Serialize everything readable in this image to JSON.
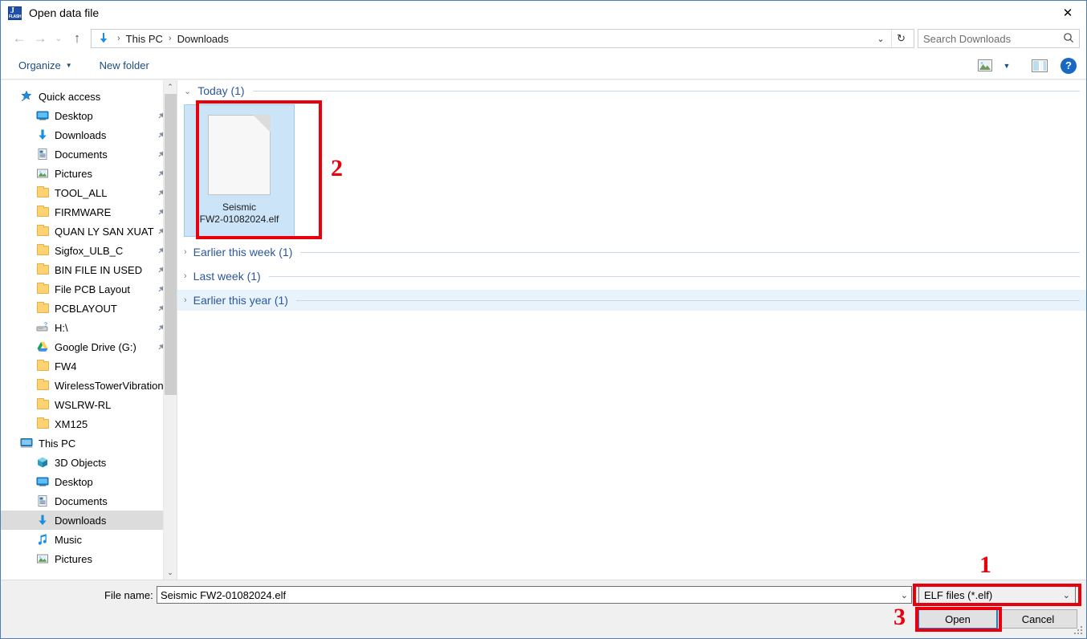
{
  "window": {
    "title": "Open data file",
    "app_icon": "jflash-icon",
    "icon_letter": "J",
    "icon_word": "FLASH",
    "close_label": "✕"
  },
  "addressbar": {
    "back": "←",
    "forward": "→",
    "recent": "⌄",
    "up": "↑",
    "crumbs": [
      "This PC",
      "Downloads"
    ],
    "separator": "›",
    "dropdown": "⌄",
    "refresh": "↻"
  },
  "search": {
    "placeholder": "Search Downloads",
    "icon": "⌕"
  },
  "commandbar": {
    "organize": "Organize",
    "organize_caret": "▼",
    "new_folder": "New folder",
    "view_caret": "▼",
    "help": "?"
  },
  "sidebar": {
    "items": [
      {
        "label": "Quick access",
        "icon": "star-icon",
        "level": 0,
        "pinned": false,
        "selected": false
      },
      {
        "label": "Desktop",
        "icon": "monitor-icon",
        "level": 1,
        "pinned": true,
        "selected": false
      },
      {
        "label": "Downloads",
        "icon": "download-icon",
        "level": 1,
        "pinned": true,
        "selected": false
      },
      {
        "label": "Documents",
        "icon": "document-icon",
        "level": 1,
        "pinned": true,
        "selected": false
      },
      {
        "label": "Pictures",
        "icon": "picture-icon",
        "level": 1,
        "pinned": true,
        "selected": false
      },
      {
        "label": "TOOL_ALL",
        "icon": "folder-icon",
        "level": 1,
        "pinned": true,
        "selected": false
      },
      {
        "label": "FIRMWARE",
        "icon": "folder-icon",
        "level": 1,
        "pinned": true,
        "selected": false
      },
      {
        "label": "QUAN LY SAN XUAT",
        "icon": "folder-icon",
        "level": 1,
        "pinned": true,
        "selected": false
      },
      {
        "label": "Sigfox_ULB_C",
        "icon": "folder-icon",
        "level": 1,
        "pinned": true,
        "selected": false
      },
      {
        "label": "BIN FILE IN USED",
        "icon": "folder-icon",
        "level": 1,
        "pinned": true,
        "selected": false
      },
      {
        "label": "File PCB Layout",
        "icon": "folder-icon",
        "level": 1,
        "pinned": true,
        "selected": false
      },
      {
        "label": "PCBLAYOUT",
        "icon": "folder-icon",
        "level": 1,
        "pinned": true,
        "selected": false
      },
      {
        "label": "H:\\",
        "icon": "drive-icon",
        "level": 1,
        "pinned": true,
        "selected": false
      },
      {
        "label": "Google Drive (G:)",
        "icon": "gdrive-icon",
        "level": 1,
        "pinned": true,
        "selected": false
      },
      {
        "label": "FW4",
        "icon": "folder-icon",
        "level": 1,
        "pinned": false,
        "selected": false
      },
      {
        "label": "WirelessTowerVibrationSensor",
        "icon": "folder-icon",
        "level": 1,
        "pinned": false,
        "selected": false
      },
      {
        "label": "WSLRW-RL",
        "icon": "folder-icon",
        "level": 1,
        "pinned": false,
        "selected": false
      },
      {
        "label": "XM125",
        "icon": "folder-icon",
        "level": 1,
        "pinned": false,
        "selected": false
      },
      {
        "label": "This PC",
        "icon": "pc-icon",
        "level": 0,
        "pinned": false,
        "selected": false
      },
      {
        "label": "3D Objects",
        "icon": "cube-icon",
        "level": 1,
        "pinned": false,
        "selected": false
      },
      {
        "label": "Desktop",
        "icon": "monitor-icon",
        "level": 1,
        "pinned": false,
        "selected": false
      },
      {
        "label": "Documents",
        "icon": "document-icon",
        "level": 1,
        "pinned": false,
        "selected": false
      },
      {
        "label": "Downloads",
        "icon": "download-icon",
        "level": 1,
        "pinned": false,
        "selected": true
      },
      {
        "label": "Music",
        "icon": "music-icon",
        "level": 1,
        "pinned": false,
        "selected": false
      },
      {
        "label": "Pictures",
        "icon": "picture-icon",
        "level": 1,
        "pinned": false,
        "selected": false
      }
    ],
    "scroll_up": "⌃",
    "scroll_down": "⌄"
  },
  "filelist": {
    "groups": [
      {
        "label": "Today (1)",
        "chevron": "⌄",
        "expanded": true,
        "highlighted": false
      },
      {
        "label": "Earlier this week (1)",
        "chevron": "›",
        "expanded": false,
        "highlighted": false
      },
      {
        "label": "Last week (1)",
        "chevron": "›",
        "expanded": false,
        "highlighted": false
      },
      {
        "label": "Earlier this year (1)",
        "chevron": "›",
        "expanded": false,
        "highlighted": true
      }
    ],
    "selected_file": {
      "name_line1": "Seismic",
      "name_line2": "FW2-01082024.elf",
      "icon": "elf-file-icon"
    }
  },
  "footer": {
    "file_name_label": "File name:",
    "file_name_value": "Seismic FW2-01082024.elf",
    "file_name_placeholder": "File name",
    "combo_caret": "⌄",
    "filter_value": "ELF files (*.elf)",
    "open_label": "Open",
    "cancel_label": "Cancel"
  },
  "annotations": {
    "one": "1",
    "two": "2",
    "three": "3",
    "color": "#e8000d"
  }
}
